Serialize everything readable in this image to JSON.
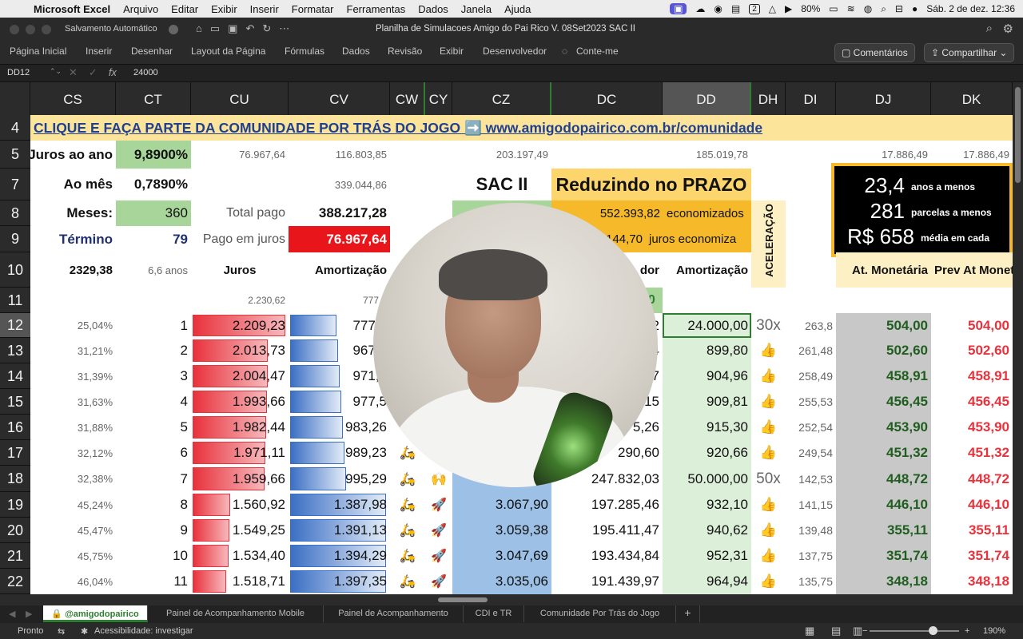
{
  "menubar": {
    "app": "Microsoft Excel",
    "items": [
      "Arquivo",
      "Editar",
      "Exibir",
      "Inserir",
      "Formatar",
      "Ferramentas",
      "Dados",
      "Janela",
      "Ajuda"
    ],
    "status_num": "2",
    "battery": "80%",
    "datetime": "Sáb. 2 de dez.  12:36"
  },
  "titlebar": {
    "autosave": "Salvamento Automático",
    "doc_title": "Planilha de Simulacoes Amigo do Pai Rico V. 08Set2023 SAC II"
  },
  "ribbon": {
    "tabs": [
      "Página Inicial",
      "Inserir",
      "Desenhar",
      "Layout da Página",
      "Fórmulas",
      "Dados",
      "Revisão",
      "Exibir",
      "Desenvolvedor",
      "Conte-me"
    ],
    "comments": "Comentários",
    "share": "Compartilhar"
  },
  "formula_bar": {
    "name_box": "DD12",
    "fx": "fx",
    "value": "24000"
  },
  "columns": [
    "CS",
    "CT",
    "CU",
    "CV",
    "CW",
    "CY",
    "CZ",
    "DC",
    "DD",
    "DH",
    "DI",
    "DJ",
    "DK"
  ],
  "rows": [
    "4",
    "5",
    "7",
    "8",
    "9",
    "10",
    "11",
    "12",
    "13",
    "14",
    "15",
    "16",
    "17",
    "18",
    "19",
    "20",
    "21",
    "22"
  ],
  "banner": "CLIQUE E FAÇA PARTE DA COMUNIDADE POR TRÁS DO JOGO ➡️ www.amigodopairico.com.br/comunidade",
  "summary": {
    "juros_ano_label": "Juros ao ano",
    "juros_ano": "9,8900%",
    "mes_label": "Ao mês",
    "mes": "0,7890%",
    "meses_label": "Meses:",
    "meses": "360",
    "termino_label": "Término",
    "termino": "79",
    "r5_cu": "76.967,64",
    "r5_cv": "116.803,85",
    "r5_cz": "203.197,49",
    "r5_dd": "185.019,78",
    "r5_dj": "17.886,49",
    "r5_dk": "17.886,49",
    "r7_cv": "339.044,86",
    "total_pago_label": "Total pago",
    "total_pago": "388.217,28",
    "pago_juros_label": "Pago em juros",
    "pago_juros": "76.967,64",
    "sac_ii": "SAC II",
    "reduzindo": "Reduzindo no PRAZO",
    "economizados_val": "552.393,82",
    "economizados": "economizados",
    "juros_econ_val": "5.144,70",
    "juros_econ": "juros economiza",
    "aceleracao": "ACELERAÇÃO",
    "anos": "23,4",
    "anos_label": "anos a menos",
    "parcelas": "281",
    "parcelas_label": "parcelas a menos",
    "media": "R$ 658",
    "media_label": "média em cada"
  },
  "row10": {
    "cs": "2329,38",
    "ct": "6,6 anos",
    "cu": "Juros",
    "cv": "Amortização",
    "dc": "dor",
    "dd": "Amortização",
    "dj": "At. Monetária",
    "dk": "Prev At Monet"
  },
  "row11": {
    "cu": "2.230,62",
    "cv": "777,7",
    "dc": "00"
  },
  "table": [
    {
      "cs": "25,04%",
      "ct": "1",
      "cu": "2.209,23",
      "cv": "777,7",
      "cz": "",
      "dc": "2",
      "dd": "24.000,00",
      "dh": "30x",
      "di": "263,8",
      "dj": "504,00",
      "dk": "504,00",
      "bar": 0.98
    },
    {
      "cs": "31,21%",
      "ct": "2",
      "cu": "2.013,73",
      "cv": "967,4",
      "cz": "",
      "dc": "4",
      "dd": "899,80",
      "dh": "👍",
      "di": "261,48",
      "dj": "502,60",
      "dk": "502,60",
      "bar": 0.8
    },
    {
      "cs": "31,39%",
      "ct": "3",
      "cu": "2.004,47",
      "cv": "971,5",
      "cz": "",
      "dc": "7",
      "dd": "904,96",
      "dh": "👍",
      "di": "258,49",
      "dj": "458,91",
      "dk": "458,91",
      "bar": 0.8
    },
    {
      "cs": "31,63%",
      "ct": "4",
      "cu": "1.993,66",
      "cv": "977,5",
      "cz": "",
      "dc": "15",
      "dd": "909,81",
      "dh": "👍",
      "di": "255,53",
      "dj": "456,45",
      "dk": "456,45",
      "bar": 0.79
    },
    {
      "cs": "31,88%",
      "ct": "5",
      "cu": "1.982,44",
      "cv": "983,26",
      "cz": "",
      "dc": "5,26",
      "dd": "915,30",
      "dh": "👍",
      "di": "252,54",
      "dj": "453,90",
      "dk": "453,90",
      "bar": 0.78
    },
    {
      "cs": "32,12%",
      "ct": "6",
      "cu": "1.971,11",
      "cv": "989,23",
      "cw": "🛵",
      "cz": "",
      "dc": "290,60",
      "dd": "920,66",
      "dh": "👍",
      "di": "249,54",
      "dj": "451,32",
      "dk": "451,32",
      "bar": 0.77
    },
    {
      "cs": "32,38%",
      "ct": "7",
      "cu": "1.959,66",
      "cv": "995,29",
      "cw": "🛵",
      "cy": "🙌",
      "cz": "",
      "dc": "247.832,03",
      "dd": "50.000,00",
      "dh": "50x",
      "di": "142,53",
      "dj": "448,72",
      "dk": "448,72",
      "bar": 0.76
    },
    {
      "cs": "45,24%",
      "ct": "8",
      "cu": "1.560,92",
      "cv": "1.387,98",
      "cw": "🛵",
      "cy": "🚀",
      "cz": "3.067,90",
      "dc": "197.285,46",
      "dd": "932,10",
      "dh": "👍",
      "di": "141,15",
      "dj": "446,10",
      "dk": "446,10",
      "bar": 0.4
    },
    {
      "cs": "45,47%",
      "ct": "9",
      "cu": "1.549,25",
      "cv": "1.391,13",
      "cw": "🛵",
      "cy": "🚀",
      "cz": "3.059,38",
      "dc": "195.411,47",
      "dd": "940,62",
      "dh": "👍",
      "di": "139,48",
      "dj": "355,11",
      "dk": "355,11",
      "bar": 0.39
    },
    {
      "cs": "45,75%",
      "ct": "10",
      "cu": "1.534,40",
      "cv": "1.394,29",
      "cw": "🛵",
      "cy": "🚀",
      "cz": "3.047,69",
      "dc": "193.434,84",
      "dd": "952,31",
      "dh": "👍",
      "di": "137,75",
      "dj": "351,74",
      "dk": "351,74",
      "bar": 0.38
    },
    {
      "cs": "46,04%",
      "ct": "11",
      "cu": "1.518,71",
      "cv": "1.397,35",
      "cw": "🛵",
      "cy": "🚀",
      "cz": "3.035,06",
      "dc": "191.439,97",
      "dd": "964,94",
      "dh": "👍",
      "di": "135,75",
      "dj": "348,18",
      "dk": "348,18",
      "bar": 0.36
    }
  ],
  "sheet_tabs": [
    "@amigodopairico",
    "Painel de Acompanhamento Mobile",
    "Painel de Acompanhamento",
    "CDI e TR",
    "Comunidade Por Trás do Jogo"
  ],
  "status": {
    "ready": "Pronto",
    "accessibility": "Acessibilidade: investigar",
    "zoom": "190%"
  }
}
